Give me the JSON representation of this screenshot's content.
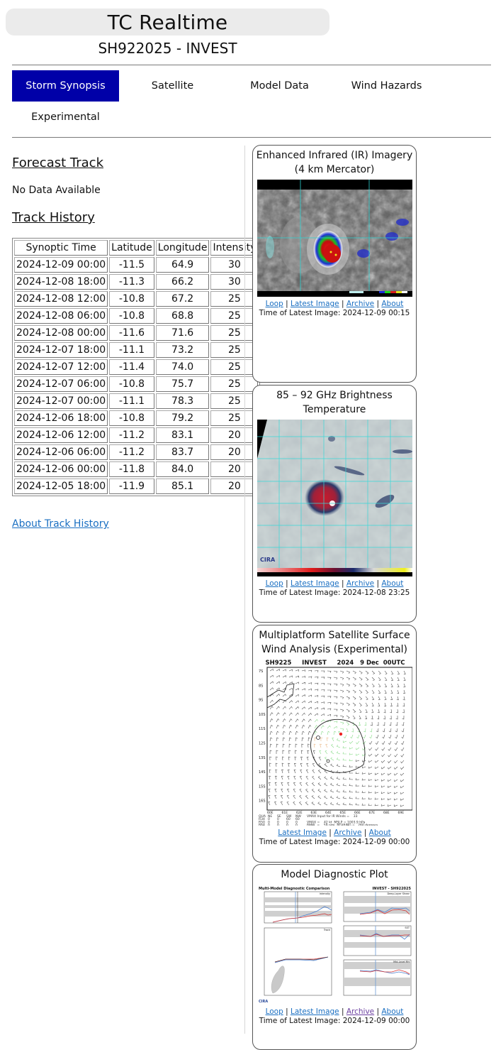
{
  "header": {
    "app_title": "TC Realtime",
    "storm_id": "SH922025 - INVEST"
  },
  "nav": {
    "tabs": [
      {
        "label": "Storm Synopsis",
        "active": true
      },
      {
        "label": "Satellite",
        "active": false
      },
      {
        "label": "Model Data",
        "active": false
      },
      {
        "label": "Wind Hazards",
        "active": false
      },
      {
        "label": "Experimental",
        "active": false
      }
    ],
    "active_color": "#0000a8"
  },
  "forecast_track": {
    "title": "Forecast Track",
    "status": "No Data Available"
  },
  "track_history": {
    "title": "Track History",
    "columns": [
      "Synoptic Time",
      "Latitude",
      "Longitude",
      "Intensity"
    ],
    "rows": [
      [
        "2024-12-09 00:00",
        "-11.5",
        "64.9",
        "30"
      ],
      [
        "2024-12-08 18:00",
        "-11.3",
        "66.2",
        "30"
      ],
      [
        "2024-12-08 12:00",
        "-10.8",
        "67.2",
        "25"
      ],
      [
        "2024-12-08 06:00",
        "-10.8",
        "68.8",
        "25"
      ],
      [
        "2024-12-08 00:00",
        "-11.6",
        "71.6",
        "25"
      ],
      [
        "2024-12-07 18:00",
        "-11.1",
        "73.2",
        "25"
      ],
      [
        "2024-12-07 12:00",
        "-11.4",
        "74.0",
        "25"
      ],
      [
        "2024-12-07 06:00",
        "-10.8",
        "75.7",
        "25"
      ],
      [
        "2024-12-07 00:00",
        "-11.1",
        "78.3",
        "25"
      ],
      [
        "2024-12-06 18:00",
        "-10.8",
        "79.2",
        "25"
      ],
      [
        "2024-12-06 12:00",
        "-11.2",
        "83.1",
        "20"
      ],
      [
        "2024-12-06 06:00",
        "-11.2",
        "83.7",
        "20"
      ],
      [
        "2024-12-06 00:00",
        "-11.8",
        "84.0",
        "20"
      ],
      [
        "2024-12-05 18:00",
        "-11.9",
        "85.1",
        "20"
      ]
    ],
    "about_link": "About Track History"
  },
  "cards": [
    {
      "title": "Enhanced Infrared (IR) Imagery (4 km Mercator)",
      "image_label": "Enhanced IR satellite image",
      "links": [
        "Loop",
        "Latest Image",
        "Archive",
        "About"
      ],
      "time_label": "Time of Latest Image: 2024-12-09 00:15"
    },
    {
      "title": "85 – 92 GHz Brightness Temperature",
      "image_label": "Microwave brightness temperature image",
      "links": [
        "Loop",
        "Latest Image",
        "Archive",
        "About"
      ],
      "time_label": "Time of Latest Image: 2024-12-08 23:25"
    },
    {
      "title": "Multiplatform Satellite Surface Wind Analysis (Experimental)",
      "image_label": "Surface wind analysis",
      "plot_header": "SH9225     INVEST     2024   9 Dec  00UTC",
      "lat_ticks": [
        "7S",
        "8S",
        "9S",
        "10S",
        "11S",
        "12S",
        "13S",
        "14S",
        "15S",
        "16S"
      ],
      "lon_ticks": [
        "60E",
        "61E",
        "62E",
        "63E",
        "64E",
        "65E",
        "66E",
        "67E",
        "68E",
        "69E"
      ],
      "radii_table": {
        "header": [
          "QUA",
          "NE",
          "SE",
          "SW",
          "NW"
        ],
        "rows": [
          [
            "R34",
            "0",
            "0",
            "60",
            "60"
          ],
          [
            "R50",
            "0",
            "0",
            "0",
            "0"
          ],
          [
            "R64",
            "0",
            "0",
            "0",
            "0"
          ]
        ],
        "notes": [
          "VMAX Input for IR Winds =    33",
          "VMAX =    42 kt  MSLP = 1003.9 hPa",
          "RMW  =    59 nmi  BEARING =   260 degrees"
        ]
      },
      "links": [
        "Latest Image",
        "Archive",
        "About"
      ],
      "time_label": "Time of Latest Image: 2024-12-09 00:00"
    },
    {
      "title": "Model Diagnostic Plot",
      "image_label": "Multi-model diagnostic comparison",
      "plot_title_left": "Multi-Model Diagnostic Comparison",
      "plot_title_right": "INVEST - SH922025",
      "panel_titles": [
        "Intensity",
        "Deep-Layer Shear",
        "Track",
        "SST",
        "Mid-Level RH"
      ],
      "links": [
        "Loop",
        "Latest Image",
        "Archive",
        "About"
      ],
      "time_label": "Time of Latest Image: 2024-12-09 00:00"
    }
  ]
}
